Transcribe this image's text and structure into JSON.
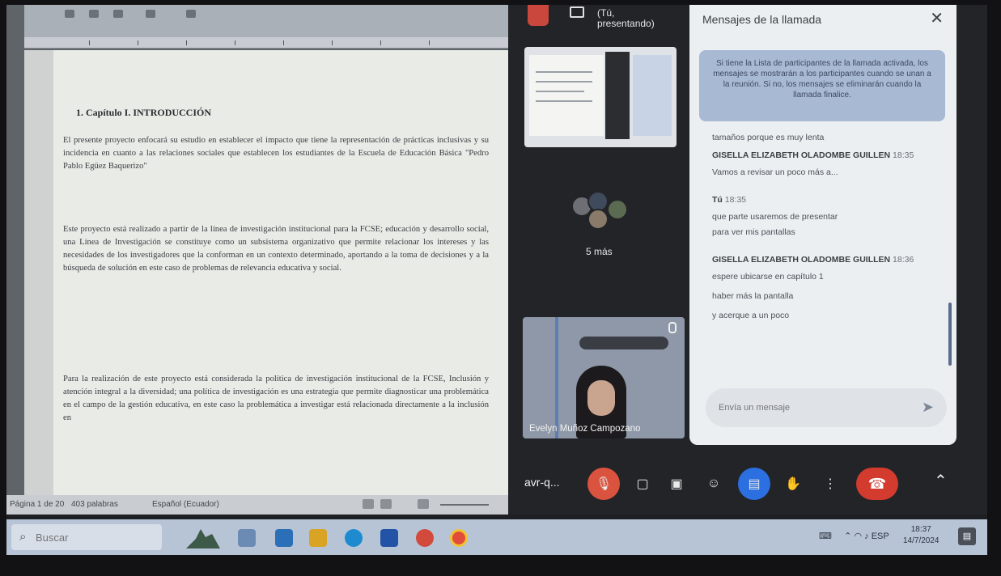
{
  "document": {
    "heading": "1.  Capítulo I. INTRODUCCIÓN",
    "paragraph1": "El presente proyecto enfocará su estudio en establecer el impacto que tiene la representación de prácticas inclusivas y su incidencia en cuanto a las relaciones sociales que establecen los estudiantes de la Escuela de Educación Básica \"Pedro Pablo Egüez Baquerizo\"",
    "paragraph2": "Este proyecto está realizado a partir de la línea de investigación institucional para la FCSE; educación y desarrollo social, una Línea de Investigación se constituye como un subsistema organizativo que permite relacionar los intereses y las necesidades de los investigadores que la conforman en un contexto determinado, aportando a la toma de decisiones y a la búsqueda de solución en este caso de problemas de relevancia educativa y social.",
    "paragraph3": "Para la realización de este proyecto está considerada la política de investigación institucional de la FCSE, Inclusión y atención integral a la diversidad; una política de investigación es una estrategia que permite diagnosticar una problemática en el campo de la gestión educativa, en este caso la problemática a investigar está relacionada directamente a la inclusión en",
    "status_page": "Página 1 de 20",
    "status_words": "403 palabras",
    "status_language": "Español (Ecuador)"
  },
  "meet": {
    "presenting_label": "(Tú, presentando)",
    "others_label": "5 más",
    "participant_name": "Evelyn Muñoz Campozano",
    "meeting_code": "avr-q...",
    "chat": {
      "title": "Mensajes de la llamada",
      "close": "✕",
      "notice": "Si tiene la Lista de participantes de la llamada activada, los mensajes se mostrarán a los participantes cuando se unan a la reunión. Si no, los mensajes se eliminarán cuando la llamada finalice.",
      "messages": [
        {
          "sender": "",
          "time": "",
          "text": [
            "tamaños porque es muy lenta"
          ]
        },
        {
          "sender": "GISELLA ELIZABETH OLADOMBE GUILLEN",
          "time": "18:35",
          "text": [
            "Vamos a revisar un poco más a..."
          ]
        },
        {
          "sender": "Tú",
          "time": "18:35",
          "text": [
            "que parte usaremos de presentar",
            "para ver mis pantallas"
          ]
        },
        {
          "sender": "GISELLA ELIZABETH OLADOMBE GUILLEN",
          "time": "18:36",
          "text": [
            "espere ubicarse en capítulo 1",
            "haber más la pantalla",
            "y acerque a un poco"
          ]
        }
      ],
      "input_placeholder": "Envía un mensaje",
      "send_icon": "send-icon"
    },
    "controls": [
      "mic-off",
      "present",
      "captions",
      "emoji",
      "raise-present",
      "hand",
      "more"
    ]
  },
  "taskbar": {
    "search_placeholder": "Buscar",
    "time": "18:37",
    "date": "14/7/2024",
    "tray_lang": "ESP"
  }
}
